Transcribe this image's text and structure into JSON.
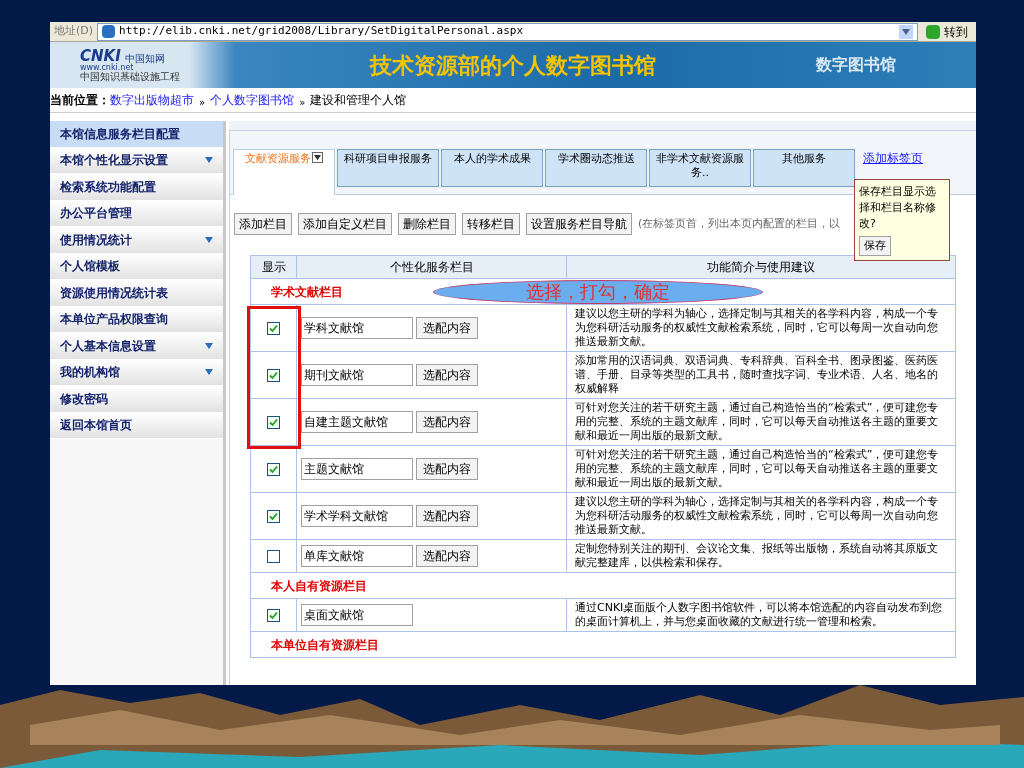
{
  "address_bar": {
    "label": "地址(D)",
    "url": "http://elib.cnki.net/grid2008/Library/SetDigitalPersonal.aspx",
    "go_button": "转到"
  },
  "banner": {
    "logo": {
      "mark": "CNKI",
      "name": "中国知网",
      "site": "www.cnki.net",
      "slogan": "中国知识基础设施工程"
    },
    "title": "技术资源部的个人数字图书馆",
    "right_title": "数字图书馆"
  },
  "breadcrumb": {
    "label": "当前位置：",
    "separator": "»",
    "items": [
      {
        "text": "数字出版物超市",
        "kind": "link"
      },
      {
        "text": "个人数字图书馆",
        "kind": "link"
      },
      {
        "text": "建设和管理个人馆",
        "kind": "current"
      }
    ]
  },
  "sidebar": {
    "items": [
      {
        "label": "本馆信息服务栏目配置",
        "selected": true,
        "expandable": false
      },
      {
        "label": "本馆个性化显示设置",
        "selected": false,
        "expandable": true
      },
      {
        "label": "检索系统功能配置",
        "selected": false,
        "expandable": false
      },
      {
        "label": "办公平台管理",
        "selected": false,
        "expandable": false
      },
      {
        "label": "使用情况统计",
        "selected": false,
        "expandable": true
      },
      {
        "label": "个人馆模板",
        "selected": false,
        "expandable": false
      },
      {
        "label": "资源使用情况统计表",
        "selected": false,
        "expandable": false
      },
      {
        "label": "本单位产品权限查询",
        "selected": false,
        "expandable": false
      },
      {
        "label": "个人基本信息设置",
        "selected": false,
        "expandable": true
      },
      {
        "label": "我的机构馆",
        "selected": false,
        "expandable": true
      },
      {
        "label": "修改密码",
        "selected": false,
        "expandable": false
      },
      {
        "label": "返回本馆首页",
        "selected": false,
        "expandable": false
      }
    ]
  },
  "tabs": [
    {
      "label": "文献资源服务",
      "selected": true,
      "dropdown": true
    },
    {
      "label": "科研项目申报服务",
      "selected": false,
      "dropdown": false
    },
    {
      "label": "本人的学术成果",
      "selected": false,
      "dropdown": false
    },
    {
      "label": "学术圈动态推送",
      "selected": false,
      "dropdown": false
    },
    {
      "label": "非学术文献资源服务..",
      "selected": false,
      "dropdown": false
    },
    {
      "label": "其他服务",
      "selected": false,
      "dropdown": false
    }
  ],
  "add_tab_link": "添加标签页",
  "toolbar": {
    "buttons": [
      "添加栏目",
      "添加自定义栏目",
      "删除栏目",
      "转移栏目",
      "设置服务栏目导航"
    ],
    "hint": "(在标签页首，列出本页内配置的栏目，以"
  },
  "popup": {
    "text": "保存栏目显示选择和栏目名称修改?",
    "button": "保存"
  },
  "callout": {
    "text": "选择，打勾，确定"
  },
  "table": {
    "columns": [
      "显示",
      "个性化服务栏目",
      "功能简介与使用建议"
    ],
    "sections": [
      {
        "title": "学术文献栏目",
        "rows": [
          {
            "checked": true,
            "highlighted": true,
            "name": "学科文献馆",
            "button": "选配内容",
            "description": "建议以您主研的学科为轴心，选择定制与其相关的各学科内容，构成一个专为您科研活动服务的权威性文献检索系统，同时，它可以每周一次自动向您推送最新文献。"
          },
          {
            "checked": true,
            "highlighted": true,
            "name": "期刊文献馆",
            "button": "选配内容",
            "description": "添加常用的汉语词典、双语词典、专科辞典、百科全书、图录图鉴、医药医谱、手册、目录等类型的工具书，随时查找字词、专业术语、人名、地名的权威解释"
          },
          {
            "checked": true,
            "highlighted": true,
            "name": "自建主题文献馆",
            "button": "选配内容",
            "description": "可针对您关注的若干研究主题，通过自己构造恰当的“检索式”，便可建您专用的完整、系统的主题文献库，同时，它可以每天自动推送各主题的重要文献和最近一周出版的最新文献。"
          },
          {
            "checked": true,
            "highlighted": false,
            "name": "主题文献馆",
            "button": "选配内容",
            "description": "可针对您关注的若干研究主题，通过自己构造恰当的“检索式”，便可建您专用的完整、系统的主题文献库，同时，它可以每天自动推送各主题的重要文献和最近一周出版的最新文献。"
          },
          {
            "checked": true,
            "highlighted": false,
            "name": "学术学科文献馆",
            "button": "选配内容",
            "description": "建议以您主研的学科为轴心，选择定制与其相关的各学科内容，构成一个专为您科研活动服务的权威性文献检索系统，同时，它可以每周一次自动向您推送最新文献。"
          },
          {
            "checked": false,
            "highlighted": false,
            "name": "单库文献馆",
            "button": "选配内容",
            "description": "定制您特别关注的期刊、会议论文集、报纸等出版物，系统自动将其原版文献完整建库，以供检索和保存。"
          }
        ]
      },
      {
        "title": "本人自有资源栏目",
        "rows": [
          {
            "checked": true,
            "highlighted": false,
            "name": "桌面文献馆",
            "description": "通过CNKI桌面版个人数字图书馆软件，可以将本馆选配的内容自动发布到您的桌面计算机上，并与您桌面收藏的文献进行统一管理和检索。"
          }
        ]
      },
      {
        "title": "本单位自有资源栏目"
      }
    ]
  }
}
